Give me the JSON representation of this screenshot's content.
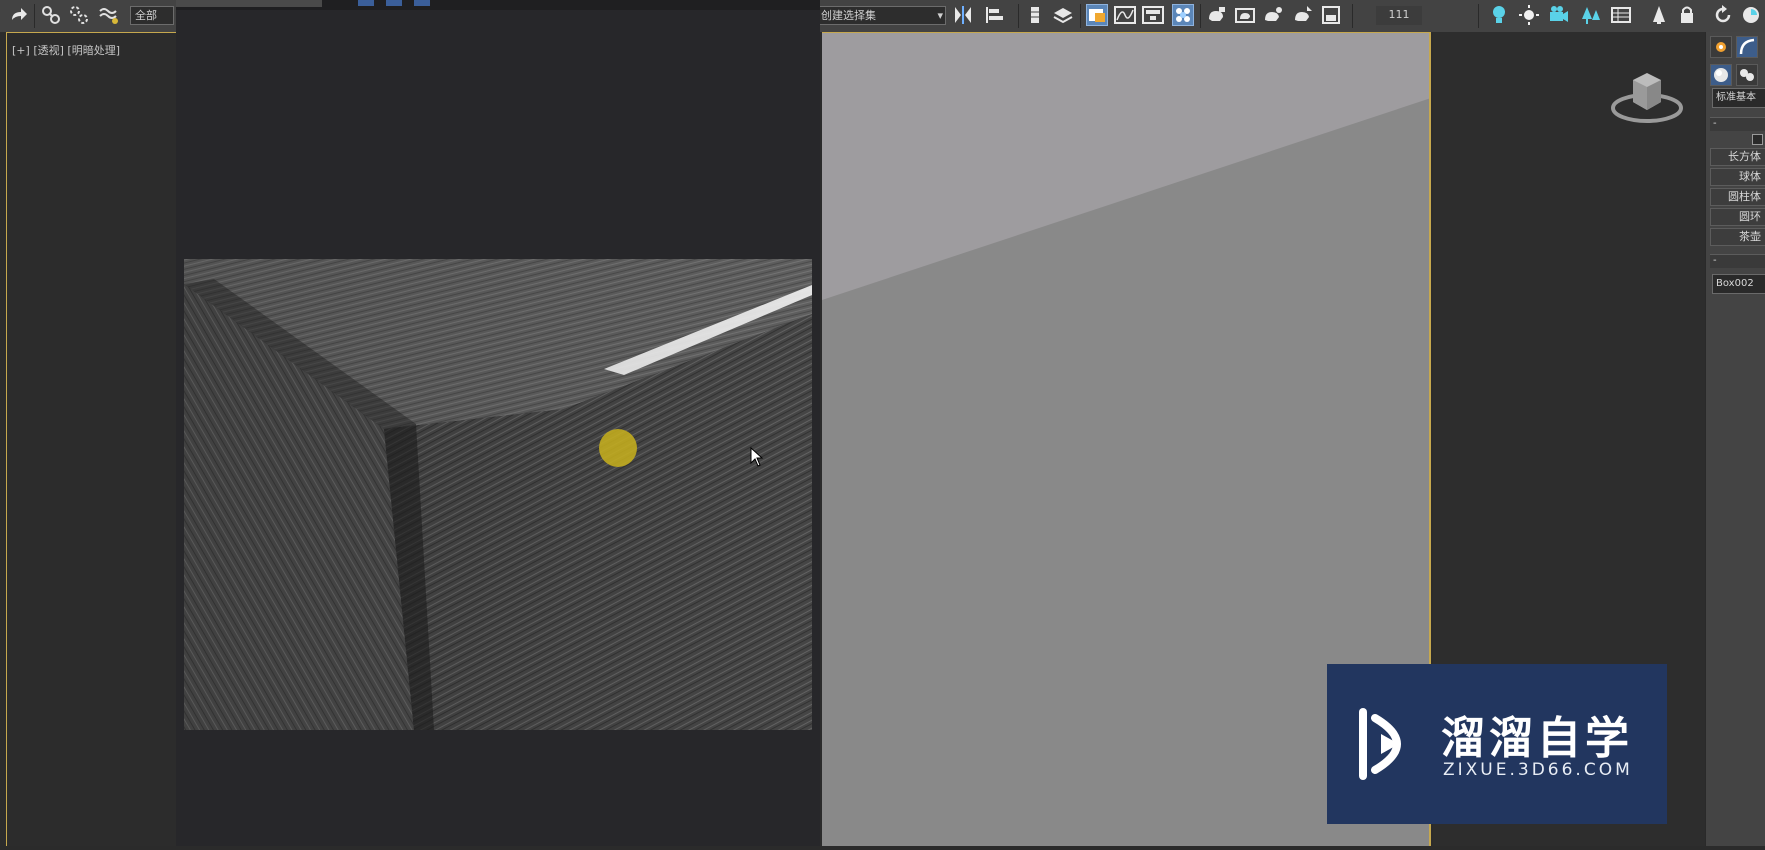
{
  "toolbar": {
    "selection_filter": "全部",
    "named_selection": "创建选择集",
    "spinner_value": "111"
  },
  "viewport_left": {
    "label_plus": "[+]",
    "label_view": "[透视]",
    "label_shading": "[明暗处理]"
  },
  "command_panel": {
    "category": "标准基本",
    "rollout_object_type": "-",
    "rollout_name": "-",
    "primitives": [
      "长方体",
      "球体",
      "圆柱体",
      "圆环",
      "茶壶"
    ],
    "object_name": "Box002"
  },
  "watermark": {
    "title": "溜溜自学",
    "url": "ZIXUE.3D66.COM"
  },
  "colors": {
    "viewport_active_border": "#c6a84e",
    "watermark_bg": "#22365f",
    "highlight_dot": "#c9b21c",
    "toolbar_bg": "#434343"
  },
  "icons": [
    "redo-icon",
    "link-icon",
    "unlink-icon",
    "bind-spacewarp-icon",
    "mirror-icon",
    "align-icon",
    "layer-manager-icon",
    "scene-explorer-icon",
    "curve-editor-icon",
    "schematic-view-icon",
    "material-editor-icon",
    "render-setup-icon",
    "render-frame-icon",
    "render-icon",
    "light-icon",
    "sun-icon",
    "camera-icon",
    "tree-icon",
    "list-icon",
    "viewcube-icon"
  ]
}
